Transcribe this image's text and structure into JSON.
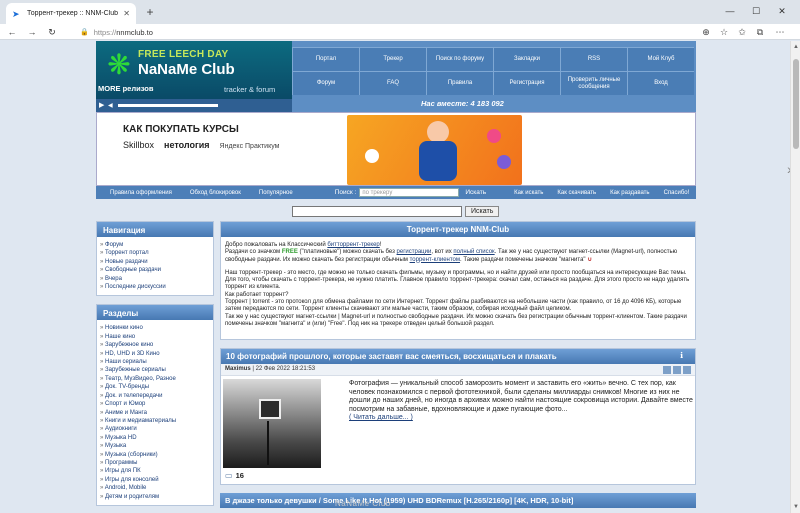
{
  "browser": {
    "tab_title": "Торрент-трекер :: NNM-Club",
    "url_protocol": "https://",
    "url_host": "nnmclub.to"
  },
  "header": {
    "logo_line1": "FREE LEECH DAY",
    "logo_line2": "NaNaMe Club",
    "logo_line3": "MORE релизов",
    "logo_line4": "tracker & forum",
    "menu": [
      "Портал",
      "Трекер",
      "Поиск по форуму",
      "Закладки",
      "",
      "Мой Клуб",
      "Форум",
      "FAQ",
      "Правила",
      "Регистрация",
      "Проверить личные сообщения",
      "Вход"
    ],
    "online": "Нас вместе: 4 183 092"
  },
  "banner": {
    "title": "КАК ПОКУПАТЬ КУРСЫ",
    "brand1": "Skillbox",
    "brand2": "нетология",
    "brand3": "Яндекс Практикум"
  },
  "subbar": {
    "items": [
      "Правила оформления",
      "Обход блокировок",
      "Популярное"
    ],
    "search_label": "Поиск :",
    "search_placeholder": "по трекеру",
    "search_button": "Искать",
    "right_items": [
      "Как искать",
      "Как скачивать",
      "Как раздавать",
      "Спасибо!"
    ]
  },
  "bigsearch": {
    "button": "Искать"
  },
  "sidebar": {
    "nav_title": "Навигация",
    "nav_items": [
      "Форум",
      "Торрент портал",
      "Новые раздачи",
      "Свободные раздачи",
      "Вчера",
      "Последние дискуссии"
    ],
    "sections_title": "Разделы",
    "section_items": [
      "Новинки кино",
      "Наше кино",
      "Зарубежное кино",
      "HD, UHD и 3D Кино",
      "Наши сериалы",
      "Зарубежные сериалы",
      "Театр, МузВидео, Разное",
      "Док. TV-бренды",
      "Док. и телепередачи",
      "Спорт и Юмор",
      "Аниме и Манга",
      "Книги и медиаматериалы",
      "Аудиокниги",
      "Музыка HD",
      "Музыка",
      "Музыка (сборники)",
      "Программы",
      "Игры для ПК",
      "Игры для консолей",
      "Android, Mobile",
      "Детям и родителям"
    ]
  },
  "main": {
    "panel_title": "Торрент-трекер NNM-Club",
    "w1a": "Добро пожаловать на Классический ",
    "w1b": "битторрент-трекер",
    "w1c": "!",
    "w2a": "Раздачи со значком ",
    "w2free": "FREE",
    "w2b": " (\"платиновые\") можно скачать без ",
    "w2reg": "регистрации",
    "w2c": ", вот их ",
    "w2list": "полный список",
    "w2d": ". Так же у нас существуют магнет-ссылки (Magnet-url), полностью свободные раздачи. Их можно скачать без регистрации обычным ",
    "w2client": "торрент-клиентом",
    "w2e": ". Такие раздачи помечены значком \"магнита\"",
    "w3": "Наш торрент-трекер - это место, где можно не только скачать фильмы, музыку и программы, но и найти друзей или просто пообщаться на интересующие Вас темы. Для того, чтобы скачать с торрент-трекера, не нужно платить. Главное правило торрент-трекера: скачал сам, останься на раздаче. Для этого просто не надо удалять торрент из клиента.",
    "w4": "Как работает торрент?",
    "w5": "Торрент | torrent - это протокол для обмена файлами по сети Интернет. Торрент файлы разбиваются на небольшие части (как правило, от 16 до 4096 КБ), которые затем передаются по сети. Торрент клиенты скачивают эти малые части, таким образом, собирая исходный файл целиком.",
    "w6": "Так же у нас существуют магнет-ссылки | Magnet-url и полностью свободные раздачи. Их можно скачать без регистрации обычным торрент-клиентом. Такие раздачи помечены значком \"магнита\" и (или) \"Free\". Под ник на трекере отведен целый большой раздел.",
    "post_title": "10 фотографий прошлого, которые заставят вас смеяться, восхищаться и плакать",
    "post_author": "Maximus",
    "post_date": " | 22 Фев 2022 18:21:53",
    "post_text": "Фотография — уникальный способ заморозить момент и заставить его «жить» вечно. С тех пор, как человек познакомился с первой фототехникой, были сделаны миллиарды снимков! Многие из них не дошли до наших дней, но иногда в архивах можно найти настоящие сокровища истории. Давайте вместе посмотрим на забавные, вдохновляющие и даже пугающие фото...",
    "read_more": "( Читать дальше... )",
    "comments": "16",
    "post2_title": "В джазе только девушки / Some Like It Hot (1959) UHD BDRemux [H.265/2160p] [4K, HDR, 10-bit]"
  },
  "watermark": "NaNaMe Club"
}
